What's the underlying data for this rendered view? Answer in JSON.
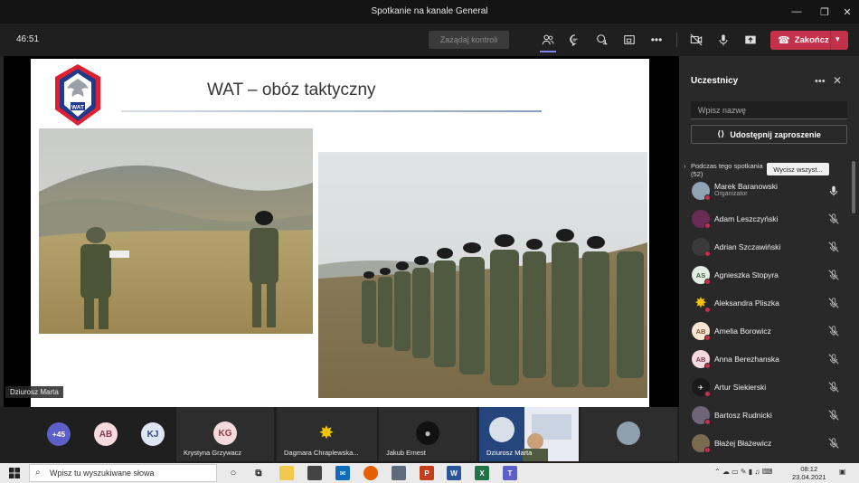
{
  "window": {
    "title": "Spotkanie na kanale General"
  },
  "toolbar": {
    "timer": "46:51",
    "request_control": "Zażądaj kontroli",
    "more": "•••",
    "end_call": "Zakończ"
  },
  "slide": {
    "title": "WAT – obóz taktyczny",
    "logo_text": "WAT"
  },
  "stage": {
    "presenter_name": "Dziurosz Marta"
  },
  "panel": {
    "title": "Uczestnicy",
    "search_placeholder": "Wpisz nazwę",
    "share_invite": "Udostępnij zaproszenie",
    "section_label": "Podczas tego spotkania",
    "section_count": "(52)",
    "mute_all": "Wycisz wszyst...",
    "participants": [
      {
        "name": "Marek Baranowski",
        "role": "Organizator",
        "initials": "",
        "avatar_color": "#8fa3b5",
        "mic": "on"
      },
      {
        "name": "Adam Leszczyński",
        "role": "",
        "initials": "",
        "avatar_color": "#6a2c55",
        "mic": "off"
      },
      {
        "name": "Adrian Szczawiński",
        "role": "",
        "initials": "",
        "avatar_color": "#3a3a3a",
        "mic": "off"
      },
      {
        "name": "Agnieszka Stopyra",
        "role": "",
        "initials": "AS",
        "avatar_color": "#e3ede3",
        "mic": "off"
      },
      {
        "name": "Aleksandra Pliszka",
        "role": "",
        "initials": "",
        "avatar_color": "#292929",
        "mic": "off"
      },
      {
        "name": "Amelia Borowicz",
        "role": "",
        "initials": "AB",
        "avatar_color": "#f6e6d3",
        "mic": "off"
      },
      {
        "name": "Anna Berezhanska",
        "role": "",
        "initials": "AB",
        "avatar_color": "#f7d9e0",
        "mic": "off"
      },
      {
        "name": "Artur Siekierski",
        "role": "",
        "initials": "",
        "avatar_color": "#1a1a1a",
        "mic": "off"
      },
      {
        "name": "Bartosz Rudnicki",
        "role": "",
        "initials": "",
        "avatar_color": "#6f6478",
        "mic": "off"
      },
      {
        "name": "Błażej Błażewicz",
        "role": "",
        "initials": "",
        "avatar_color": "#7a6a50",
        "mic": "off"
      }
    ]
  },
  "strip": {
    "overflow": "+45",
    "avatars": [
      {
        "initials": "AB",
        "color": "#f7d9e0",
        "text_color": "#7a3a50"
      },
      {
        "initials": "KJ",
        "color": "#dfe6f3",
        "text_color": "#334a7a"
      }
    ],
    "tiles": [
      {
        "name": "Krystyna Grzywacz",
        "initials": "KG",
        "color": "#f6d9dc",
        "text_color": "#8a3a44"
      },
      {
        "name": "Dagmara Chraplewska...",
        "initials": "",
        "color": "#2d2d2d",
        "text_color": "#fff"
      },
      {
        "name": "Jakub Ernest",
        "initials": "",
        "color": "#111",
        "text_color": "#fff"
      },
      {
        "name": "Dziurosz Marta",
        "initials": "",
        "color": "#2d2d2d",
        "text_color": "#fff"
      }
    ]
  },
  "taskbar": {
    "search_placeholder": "Wpisz tu wyszukiwane słowa",
    "time": "08:12",
    "date": "23.04.2021"
  },
  "colors": {
    "accent": "#7f85f5",
    "end_call": "#c4314b",
    "muted_dot": "#c4314b"
  }
}
